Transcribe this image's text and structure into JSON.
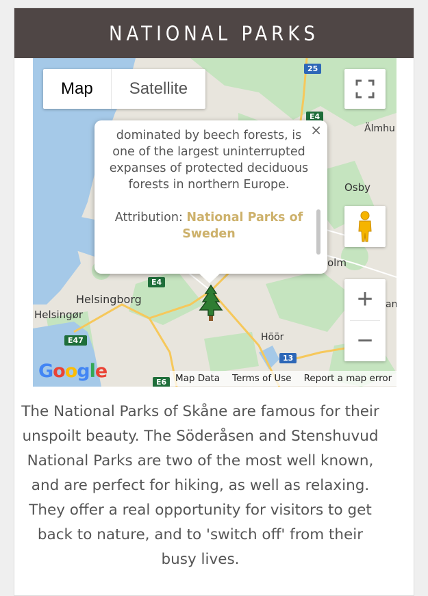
{
  "header": {
    "title": "NATIONAL PARKS"
  },
  "map": {
    "map_type_options": [
      "Map",
      "Satellite"
    ],
    "selected_type": "Map",
    "labels": {
      "helsingborg": "Helsingborg",
      "helsingor": "Helsingør",
      "hoor": "Höör",
      "osby": "Osby",
      "almhult": "Älmhu",
      "olm": "olm",
      "an": "an"
    },
    "road_shields": {
      "r25": "25",
      "e4_top": "E4",
      "e4_mid": "E4",
      "e47": "E47",
      "r13": "13",
      "e6": "E6"
    },
    "info_window": {
      "text": "dominated by beech forests, is one of the largest uninterrupted expanses of protected deciduous forests in northern Europe.",
      "attribution_label": "Attribution:",
      "attribution_link": "National Parks of Sweden",
      "close_glyph": "×"
    },
    "marker_icon": "pine-tree-icon",
    "zoom_in": "+",
    "zoom_out": "−",
    "google_logo": [
      "G",
      "o",
      "o",
      "g",
      "l",
      "e"
    ],
    "footer": {
      "map_data": "Map Data",
      "terms": "Terms of Use",
      "report": "Report a map error"
    }
  },
  "description": "The National Parks of Skåne are famous for their unspoilt beauty. The Söderåsen and Stenshuvud National Parks are two of the most well known, and are perfect for hiking, as well as relaxing. They offer a real opportunity for visitors to get back to nature, and to 'switch off' from their busy lives.",
  "colors": {
    "header_bg": "#4f4645",
    "accent_link": "#cdb16b",
    "water": "#a5c9e8",
    "land": "#e8e5dd",
    "forest": "#c5e4bf"
  }
}
